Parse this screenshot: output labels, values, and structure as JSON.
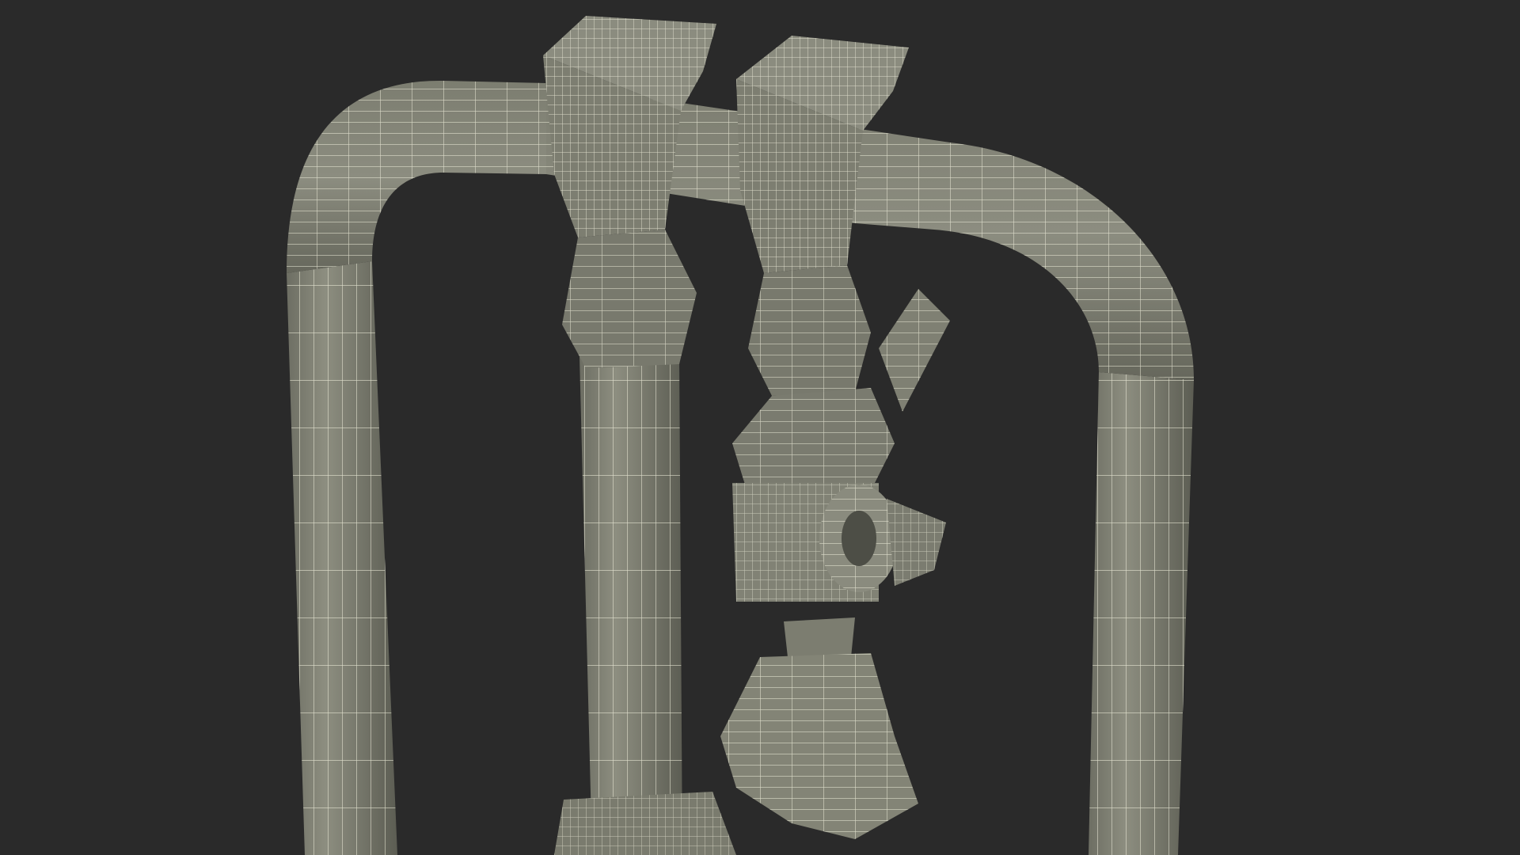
{
  "scene": {
    "background_color": "#2a2a2a",
    "mesh_fill_color": "#838476",
    "mesh_shadow_color": "#5e5f55",
    "wire_color": "#ecebd8"
  }
}
